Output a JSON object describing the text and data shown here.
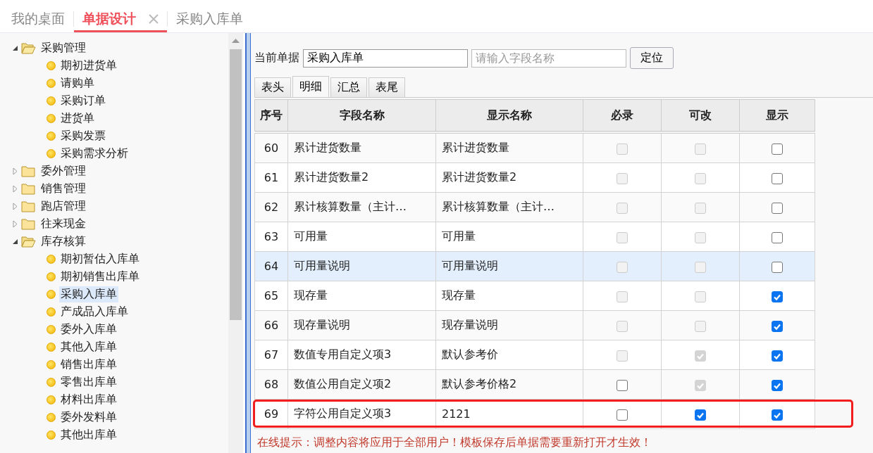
{
  "tabs": [
    {
      "label": "我的桌面",
      "selected": false,
      "closable": false
    },
    {
      "label": "单据设计",
      "selected": true,
      "closable": true
    },
    {
      "label": "采购入库单",
      "selected": false,
      "closable": false
    }
  ],
  "tree": [
    {
      "label": "采购管理",
      "expanded": true,
      "children": [
        {
          "label": "期初进货单",
          "selected": false
        },
        {
          "label": "请购单",
          "selected": false
        },
        {
          "label": "采购订单",
          "selected": false
        },
        {
          "label": "进货单",
          "selected": false
        },
        {
          "label": "采购发票",
          "selected": false
        },
        {
          "label": "采购需求分析",
          "selected": false
        }
      ]
    },
    {
      "label": "委外管理",
      "expanded": false
    },
    {
      "label": "销售管理",
      "expanded": false
    },
    {
      "label": "跑店管理",
      "expanded": false
    },
    {
      "label": "往来现金",
      "expanded": false
    },
    {
      "label": "库存核算",
      "expanded": true,
      "children": [
        {
          "label": "期初暂估入库单",
          "selected": false
        },
        {
          "label": "期初销售出库单",
          "selected": false
        },
        {
          "label": "采购入库单",
          "selected": true
        },
        {
          "label": "产成品入库单",
          "selected": false
        },
        {
          "label": "委外入库单",
          "selected": false
        },
        {
          "label": "其他入库单",
          "selected": false
        },
        {
          "label": "销售出库单",
          "selected": false
        },
        {
          "label": "零售出库单",
          "selected": false
        },
        {
          "label": "材料出库单",
          "selected": false
        },
        {
          "label": "委外发料单",
          "selected": false
        },
        {
          "label": "其他出库单",
          "selected": false
        }
      ]
    }
  ],
  "toolbar": {
    "label": "当前单据",
    "document": "采购入库单",
    "search_placeholder": "请输入字段名称",
    "locate_button": "定位"
  },
  "sub_tabs": [
    {
      "label": "表头",
      "selected": false
    },
    {
      "label": "明细",
      "selected": true
    },
    {
      "label": "汇总",
      "selected": false
    },
    {
      "label": "表尾",
      "selected": false
    }
  ],
  "table": {
    "columns": [
      "序号",
      "字段名称",
      "显示名称",
      "必录",
      "可改",
      "显示"
    ],
    "rows": [
      {
        "no": "60",
        "field": "累计进货数量",
        "display": "累计进货数量",
        "selected": false,
        "highlighted": false,
        "checks": [
          {
            "checked": false,
            "disabled": true
          },
          {
            "checked": false,
            "disabled": true
          },
          {
            "checked": false,
            "disabled": false
          }
        ]
      },
      {
        "no": "61",
        "field": "累计进货数量2",
        "display": "累计进货数量2",
        "selected": false,
        "highlighted": false,
        "checks": [
          {
            "checked": false,
            "disabled": true
          },
          {
            "checked": false,
            "disabled": true
          },
          {
            "checked": false,
            "disabled": false
          }
        ]
      },
      {
        "no": "62",
        "field": "累计核算数量（主计…",
        "display": "累计核算数量（主计…",
        "selected": false,
        "highlighted": false,
        "checks": [
          {
            "checked": false,
            "disabled": true
          },
          {
            "checked": false,
            "disabled": true
          },
          {
            "checked": false,
            "disabled": false
          }
        ]
      },
      {
        "no": "63",
        "field": "可用量",
        "display": "可用量",
        "selected": false,
        "highlighted": false,
        "checks": [
          {
            "checked": false,
            "disabled": true
          },
          {
            "checked": false,
            "disabled": true
          },
          {
            "checked": false,
            "disabled": false
          }
        ]
      },
      {
        "no": "64",
        "field": "可用量说明",
        "display": "可用量说明",
        "selected": true,
        "highlighted": false,
        "checks": [
          {
            "checked": false,
            "disabled": true
          },
          {
            "checked": false,
            "disabled": true
          },
          {
            "checked": false,
            "disabled": false
          }
        ]
      },
      {
        "no": "65",
        "field": "现存量",
        "display": "现存量",
        "selected": false,
        "highlighted": false,
        "checks": [
          {
            "checked": false,
            "disabled": true
          },
          {
            "checked": false,
            "disabled": true
          },
          {
            "checked": true,
            "disabled": false
          }
        ]
      },
      {
        "no": "66",
        "field": "现存量说明",
        "display": "现存量说明",
        "selected": false,
        "highlighted": false,
        "checks": [
          {
            "checked": false,
            "disabled": true
          },
          {
            "checked": false,
            "disabled": true
          },
          {
            "checked": true,
            "disabled": false
          }
        ]
      },
      {
        "no": "67",
        "field": "数值专用自定义项3",
        "display": "默认参考价",
        "selected": false,
        "highlighted": false,
        "checks": [
          {
            "checked": false,
            "disabled": true
          },
          {
            "checked": true,
            "disabled": true
          },
          {
            "checked": true,
            "disabled": false
          }
        ]
      },
      {
        "no": "68",
        "field": "数值公用自定义项2",
        "display": "默认参考价格2",
        "selected": false,
        "highlighted": false,
        "checks": [
          {
            "checked": false,
            "disabled": false
          },
          {
            "checked": true,
            "disabled": true
          },
          {
            "checked": true,
            "disabled": false
          }
        ]
      },
      {
        "no": "69",
        "field": "字符公用自定义项3",
        "display": "2121",
        "selected": false,
        "highlighted": true,
        "checks": [
          {
            "checked": false,
            "disabled": false
          },
          {
            "checked": true,
            "disabled": false
          },
          {
            "checked": true,
            "disabled": false
          }
        ]
      }
    ]
  },
  "notice": "在线提示：调整内容将应用于全部用户！模板保存后单据需要重新打开才生效！"
}
